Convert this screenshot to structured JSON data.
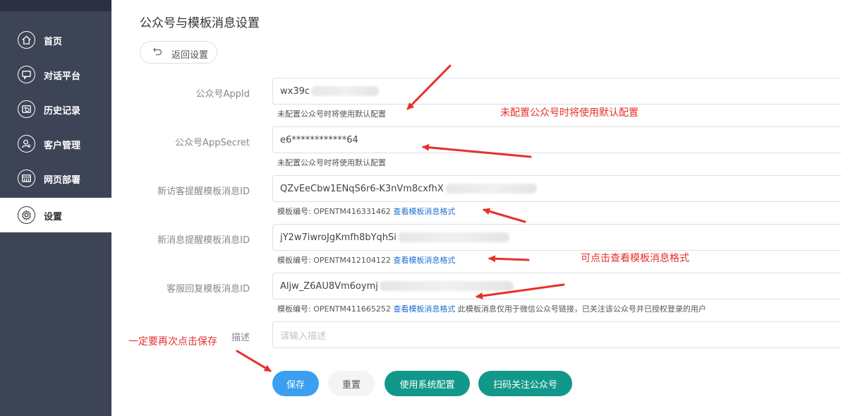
{
  "sidebar": {
    "items": [
      {
        "label": "首页",
        "icon": "home-icon"
      },
      {
        "label": "对话平台",
        "icon": "chat-icon"
      },
      {
        "label": "历史记录",
        "icon": "history-icon"
      },
      {
        "label": "客户管理",
        "icon": "user-icon"
      },
      {
        "label": "网页部署",
        "icon": "web-icon"
      },
      {
        "label": "设置",
        "icon": "gear-icon",
        "active": true
      }
    ]
  },
  "page": {
    "title": "公众号与模板消息设置",
    "back_label": "返回设置"
  },
  "form": {
    "appid": {
      "label": "公众号AppId",
      "value": "wx39c",
      "hint": "未配置公众号时将使用默认配置"
    },
    "appsecret": {
      "label": "公众号AppSecret",
      "value": "e6************64",
      "hint": "未配置公众号时将使用默认配置"
    },
    "visitor_template": {
      "label": "新访客提醒模板消息ID",
      "value": "QZvEeCbw1ENqS6r6-K3nVm8cxfhX",
      "hint_prefix": "模板编号: OPENTM416331462",
      "hint_link": "查看模板消息格式"
    },
    "message_template": {
      "label": "新消息提醒模板消息ID",
      "value": "jY2w7iwroJgKmfh8bYqhSi",
      "hint_prefix": "模板编号: OPENTM412104122",
      "hint_link": "查看模板消息格式"
    },
    "reply_template": {
      "label": "客服回复模板消息ID",
      "value": "Aljw_Z6AU8Vm6oymj",
      "hint_prefix": "模板编号: OPENTM411665252",
      "hint_link": "查看模板消息格式",
      "hint_suffix": "此模板消息仅用于微信公众号链接，已关注该公众号并已授权登录的用户"
    },
    "description": {
      "label": "描述",
      "placeholder": "请输入描述"
    }
  },
  "buttons": {
    "save": "保存",
    "reset": "重置",
    "use_system": "使用系统配置",
    "scan_follow": "扫码关注公众号"
  },
  "annotations": {
    "default_config": "未配置公众号时将使用默认配置",
    "view_format": "可点击查看模板消息格式",
    "save_again": "一定要再次点击保存"
  },
  "colors": {
    "sidebar_bg": "#3d4456",
    "primary": "#3a9ff0",
    "teal": "#12988a",
    "annotation": "#e5312a",
    "link": "#1f6fd1"
  }
}
